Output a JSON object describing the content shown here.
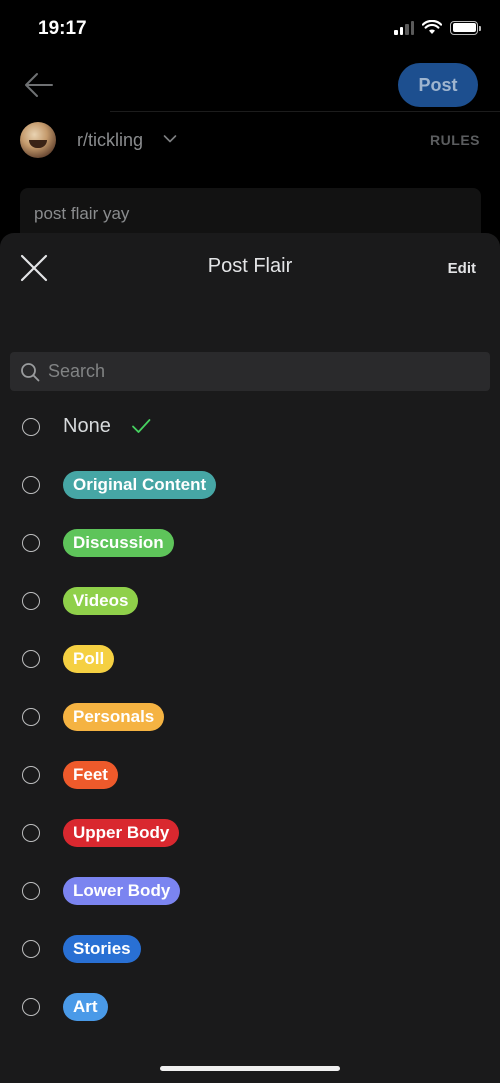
{
  "status": {
    "time": "19:17"
  },
  "composer": {
    "post_label": "Post",
    "community": "r/tickling",
    "rules_label": "RULES",
    "title_value": "post flair yay"
  },
  "sheet": {
    "title": "Post Flair",
    "edit_label": "Edit",
    "search_placeholder": "Search"
  },
  "flairs": [
    {
      "label": "None",
      "color": null,
      "selected": true
    },
    {
      "label": "Original Content",
      "color": "#46a6a5",
      "selected": false
    },
    {
      "label": "Discussion",
      "color": "#5ec45a",
      "selected": false
    },
    {
      "label": "Videos",
      "color": "#8fd04a",
      "selected": false
    },
    {
      "label": "Poll",
      "color": "#f5d042",
      "selected": false
    },
    {
      "label": "Personals",
      "color": "#f5b342",
      "selected": false
    },
    {
      "label": "Feet",
      "color": "#ee5a2b",
      "selected": false
    },
    {
      "label": "Upper Body",
      "color": "#d9282f",
      "selected": false
    },
    {
      "label": "Lower Body",
      "color": "#7b84f0",
      "selected": false
    },
    {
      "label": "Stories",
      "color": "#2970d4",
      "selected": false
    },
    {
      "label": "Art",
      "color": "#4a9ae8",
      "selected": false
    }
  ],
  "icons": {
    "back": "arrow-left-icon",
    "chevron": "chevron-down-icon",
    "close": "close-icon",
    "search": "search-icon",
    "check": "checkmark-icon"
  },
  "colors": {
    "post_button": "#1d4f8f",
    "sheet_bg": "#1a1a1b",
    "check": "#46d160"
  }
}
